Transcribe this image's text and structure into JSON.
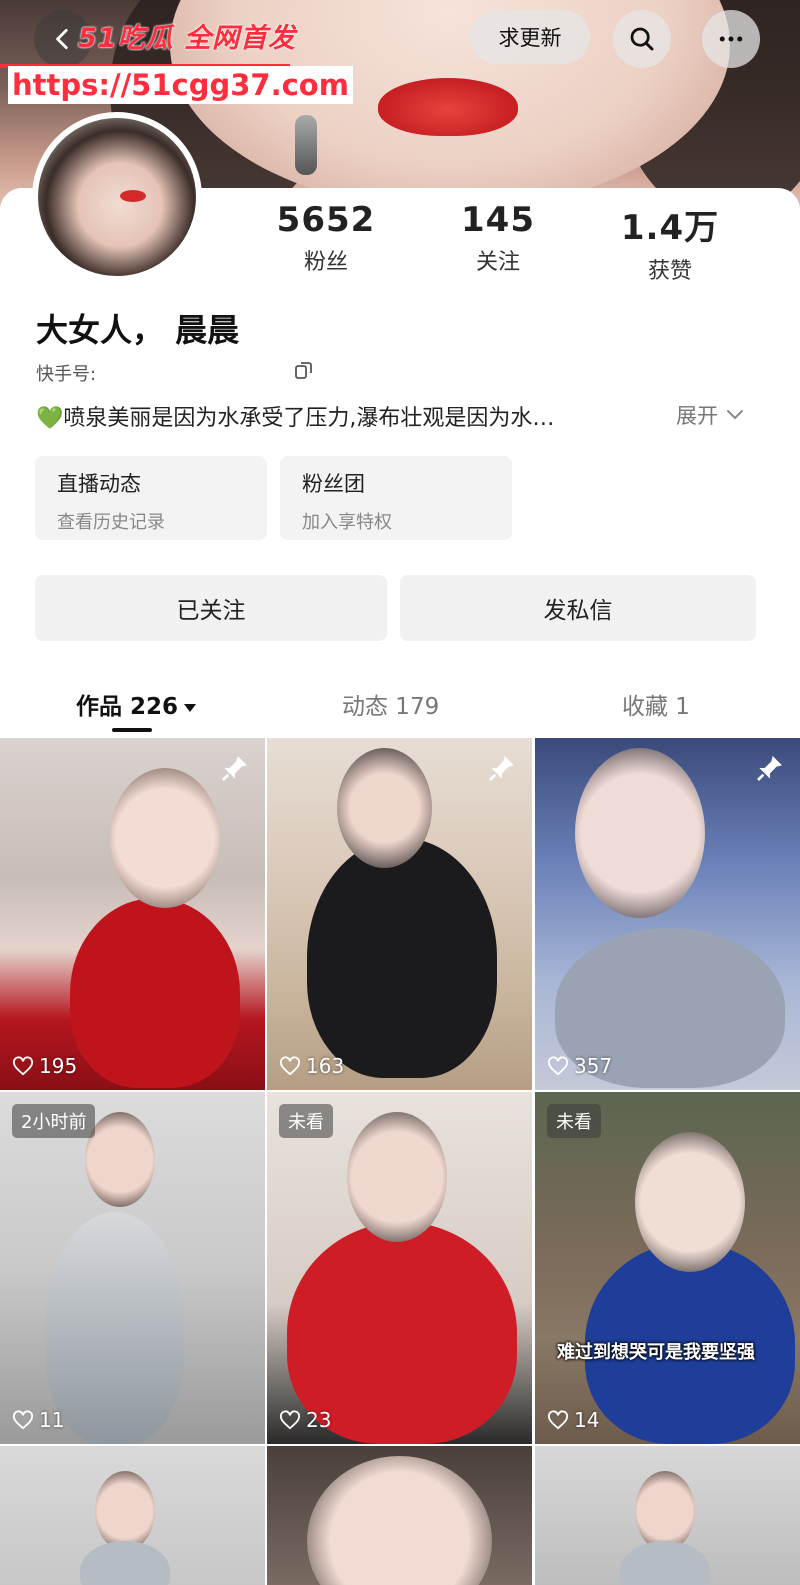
{
  "header": {
    "watermark": "51吃瓜 全网首发",
    "watermark_url": "https://51cgg37.com",
    "update_button": "求更新",
    "icons": [
      "back-icon",
      "search-icon",
      "more-icon"
    ]
  },
  "profile": {
    "stats": [
      {
        "value": "5652",
        "label": "粉丝"
      },
      {
        "value": "145",
        "label": "关注"
      },
      {
        "value": "1.4万",
        "label": "获赞"
      }
    ],
    "name": "大女人， 晨晨",
    "uid_label": "快手号:",
    "bio_emoji": "💚",
    "bio": "喷泉美丽是因为水承受了压力,瀑布壮观是因为水…",
    "expand": "展开"
  },
  "mini_cards": [
    {
      "title": "直播动态",
      "subtitle": "查看历史记录"
    },
    {
      "title": "粉丝团",
      "subtitle": "加入享特权"
    }
  ],
  "actions": {
    "follow": "已关注",
    "message": "发私信"
  },
  "tabs": [
    {
      "label": "作品 226",
      "active": true
    },
    {
      "label": "动态 179",
      "active": false
    },
    {
      "label": "收藏 1",
      "active": false
    }
  ],
  "videos": [
    {
      "likes": "195",
      "pinned": true,
      "badge": "",
      "caption": ""
    },
    {
      "likes": "163",
      "pinned": true,
      "badge": "",
      "caption": ""
    },
    {
      "likes": "357",
      "pinned": true,
      "badge": "",
      "caption": ""
    },
    {
      "likes": "11",
      "pinned": false,
      "badge": "2小时前",
      "caption": ""
    },
    {
      "likes": "23",
      "pinned": false,
      "badge": "未看",
      "caption": ""
    },
    {
      "likes": "14",
      "pinned": false,
      "badge": "未看",
      "caption": "难过到想哭可是我要坚强"
    },
    {
      "likes": "",
      "pinned": false,
      "badge": "",
      "caption": ""
    },
    {
      "likes": "",
      "pinned": false,
      "badge": "",
      "caption": ""
    },
    {
      "likes": "",
      "pinned": false,
      "badge": "",
      "caption": ""
    }
  ],
  "colors": {
    "watermark": "#ff2d3e",
    "accent_red": "#d62a2a",
    "bio_heart": "#3fae3f"
  }
}
